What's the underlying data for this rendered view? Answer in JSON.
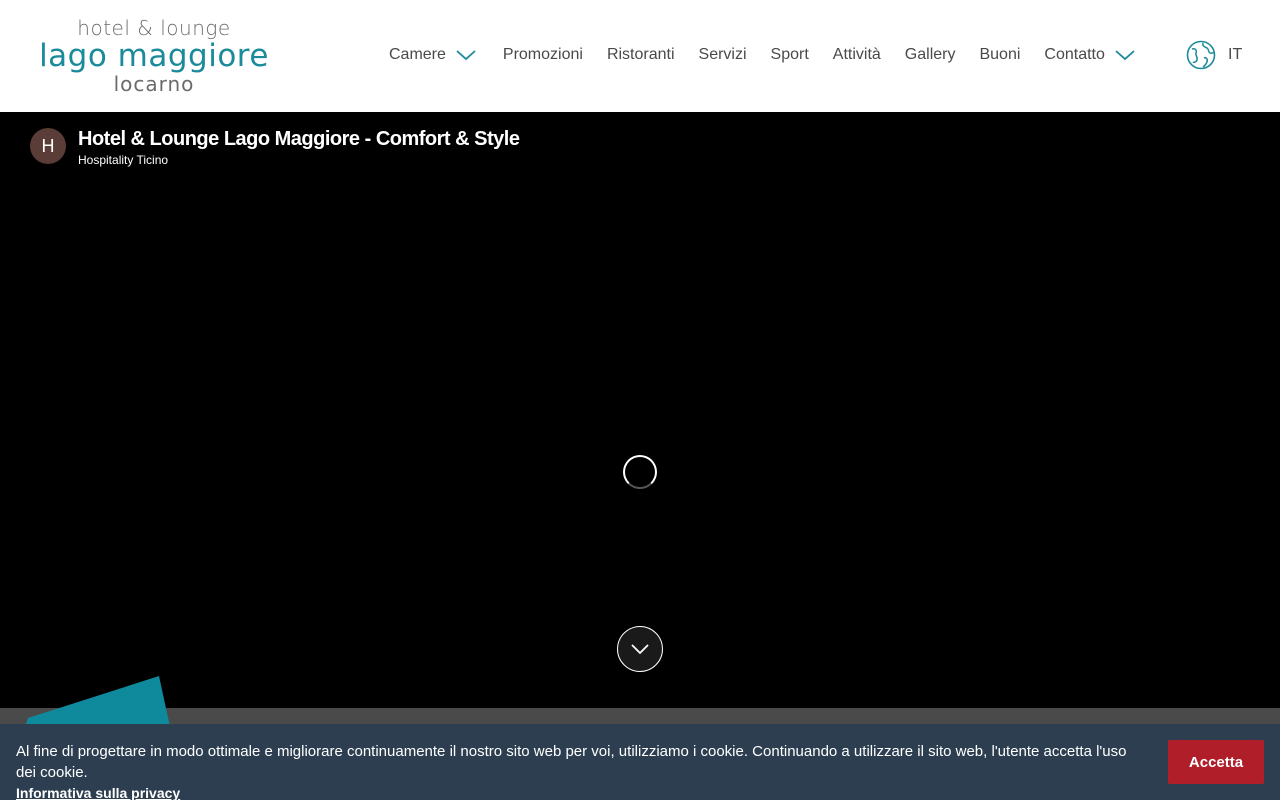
{
  "logo": {
    "line1": "hotel & lounge",
    "line2": "lago maggiore",
    "line3": "locarno"
  },
  "nav": {
    "items": [
      {
        "label": "Camere",
        "dropdown": true
      },
      {
        "label": "Promozioni"
      },
      {
        "label": "Ristoranti"
      },
      {
        "label": "Servizi"
      },
      {
        "label": "Sport"
      },
      {
        "label": "Attività"
      },
      {
        "label": "Gallery"
      },
      {
        "label": "Buoni"
      },
      {
        "label": "Contatto",
        "dropdown": true
      }
    ],
    "language": "IT",
    "icons": {
      "dropdown": "chevron-down-icon",
      "language": "globe-icon"
    }
  },
  "video": {
    "avatar_letter": "H",
    "title": "Hotel & Lounge Lago Maggiore - Comfort & Style",
    "channel": "Hospitality Ticino",
    "icons": {
      "loading": "loading-spinner-icon",
      "scroll": "chevron-down-icon"
    }
  },
  "cookie": {
    "message": "Al fine di progettare in modo ottimale e migliorare continuamente il nostro sito web per voi, utilizziamo i cookie. Continuando a utilizzare il sito web, l'utente accetta l'uso dei cookie.",
    "privacy_link": "Informativa sulla privacy",
    "accept_label": "Accetta"
  },
  "colors": {
    "brand_teal": "#1b8a9a",
    "logo_grey": "#6b6b6b",
    "nav_text": "#4a4a4a",
    "cookie_bg": "#2c3e50",
    "accept_bg": "#b01e2a",
    "avatar_bg": "#5a3d37"
  }
}
